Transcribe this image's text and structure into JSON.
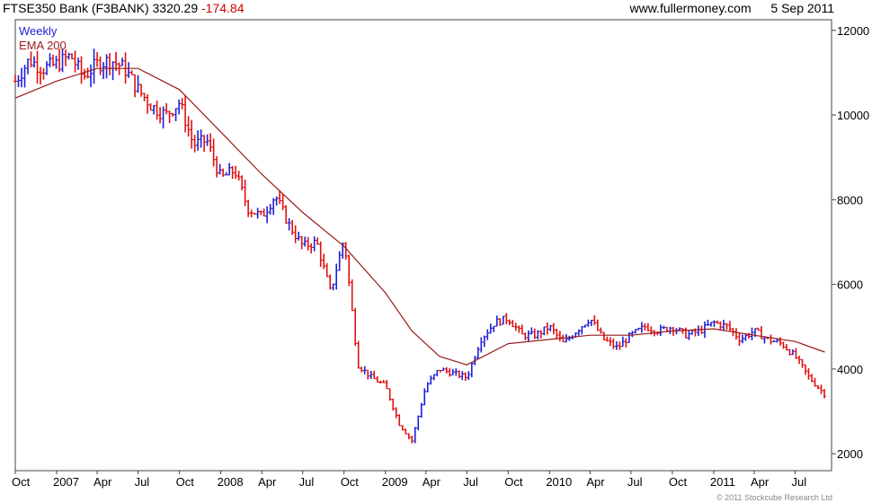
{
  "header": {
    "symbol": "FTSE350 Bank (F3BANK)",
    "last": "3320.29",
    "change": "-174.84",
    "site": "www.fullermoney.com",
    "date": "5 Sep 2011"
  },
  "legend": {
    "series1": "Weekly",
    "series2": "EMA 200"
  },
  "credit": "© 2011 Stockcube Research Ltd",
  "colors": {
    "up": "#1f1fd6",
    "down": "#e01010",
    "ema": "#9b1b1b",
    "frame": "#444444"
  },
  "chart_data": {
    "type": "line",
    "ylim": [
      1600,
      12250
    ],
    "yticks": [
      2000,
      4000,
      6000,
      8000,
      10000,
      12000
    ],
    "x_labels": [
      "Oct",
      "2007",
      "Apr",
      "Jul",
      "Oct",
      "2008",
      "Apr",
      "Jul",
      "Oct",
      "2009",
      "Apr",
      "Jul",
      "Oct",
      "2010",
      "Apr",
      "Jul",
      "Oct",
      "2011",
      "Apr",
      "Jul"
    ],
    "x_start": "2006-10-01",
    "x_end": "2011-09-20",
    "x_tick_dates": [
      "2006-10-01",
      "2007-01-01",
      "2007-04-01",
      "2007-07-01",
      "2007-10-01",
      "2008-01-01",
      "2008-04-01",
      "2008-07-01",
      "2008-10-01",
      "2009-01-01",
      "2009-04-01",
      "2009-07-01",
      "2009-10-01",
      "2010-01-01",
      "2010-04-01",
      "2010-07-01",
      "2010-10-01",
      "2011-01-01",
      "2011-04-01",
      "2011-07-01"
    ],
    "series": [
      {
        "name": "Weekly",
        "style": "ohlc-weekly",
        "x": [
          "2006-10-01",
          "2006-11-01",
          "2006-12-01",
          "2007-01-01",
          "2007-02-01",
          "2007-03-01",
          "2007-04-01",
          "2007-05-01",
          "2007-06-01",
          "2007-07-01",
          "2007-08-01",
          "2007-09-01",
          "2007-10-01",
          "2007-11-01",
          "2007-12-01",
          "2008-01-01",
          "2008-02-01",
          "2008-03-01",
          "2008-04-01",
          "2008-05-01",
          "2008-06-01",
          "2008-07-01",
          "2008-08-01",
          "2008-09-01",
          "2008-10-01",
          "2008-11-01",
          "2008-12-01",
          "2009-01-01",
          "2009-02-01",
          "2009-03-01",
          "2009-04-01",
          "2009-05-01",
          "2009-06-01",
          "2009-07-01",
          "2009-08-01",
          "2009-09-01",
          "2009-10-01",
          "2009-11-01",
          "2009-12-01",
          "2010-01-01",
          "2010-02-01",
          "2010-03-01",
          "2010-04-01",
          "2010-05-01",
          "2010-06-01",
          "2010-07-01",
          "2010-08-01",
          "2010-09-01",
          "2010-10-01",
          "2010-11-01",
          "2010-12-01",
          "2011-01-01",
          "2011-02-01",
          "2011-03-01",
          "2011-04-01",
          "2011-05-01",
          "2011-06-01",
          "2011-07-01",
          "2011-08-01",
          "2011-09-05"
        ],
        "y": [
          10800,
          11300,
          11100,
          11200,
          11400,
          10900,
          11200,
          11300,
          11100,
          10600,
          10200,
          10000,
          10300,
          9300,
          9400,
          8500,
          8700,
          7800,
          7600,
          8100,
          7400,
          6900,
          7000,
          5800,
          7100,
          4100,
          3800,
          3600,
          2700,
          2300,
          3600,
          4000,
          3900,
          3800,
          4700,
          5100,
          5200,
          4800,
          4800,
          5000,
          4600,
          4900,
          5200,
          4700,
          4500,
          4800,
          5000,
          4900,
          5000,
          4800,
          4900,
          5100,
          5000,
          4700,
          4900,
          4700,
          4600,
          4300,
          3800,
          3400
        ]
      },
      {
        "name": "EMA 200",
        "style": "line",
        "x": [
          "2006-10-01",
          "2007-01-01",
          "2007-04-01",
          "2007-07-01",
          "2007-10-01",
          "2008-01-01",
          "2008-04-01",
          "2008-07-01",
          "2008-10-01",
          "2009-01-01",
          "2009-03-01",
          "2009-05-01",
          "2009-07-01",
          "2009-10-01",
          "2010-01-01",
          "2010-04-01",
          "2010-07-01",
          "2010-10-01",
          "2011-01-01",
          "2011-04-01",
          "2011-07-01",
          "2011-09-05"
        ],
        "y": [
          10400,
          10800,
          11100,
          11100,
          10600,
          9600,
          8600,
          7700,
          6900,
          5800,
          4900,
          4300,
          4100,
          4600,
          4700,
          4800,
          4800,
          4900,
          4950,
          4800,
          4650,
          4400
        ]
      }
    ]
  }
}
